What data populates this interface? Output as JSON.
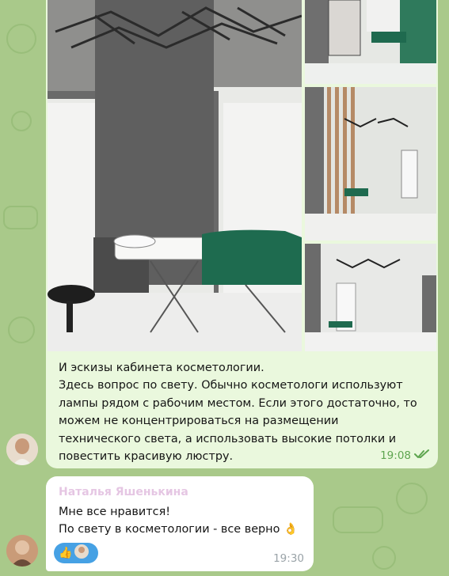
{
  "chat": {
    "outgoing": {
      "lines": [
        "И эскизы кабинета косметологии.",
        "Здесь вопрос по свету. Обычно косметологи используют",
        "лампы рядом с рабочим местом. Если этого достаточно, то",
        "можем не концентрироваться на размещении",
        "технического света, а использовать высокие потолки и",
        "повестить красивую люстру."
      ],
      "time": "19:08",
      "status_icon": "double-check-icon"
    },
    "incoming": {
      "sender": "Наталья Яшенькина",
      "lines": [
        "Мне все нравится!",
        "По свету в косметологии - все верно 👌"
      ],
      "time": "19:30",
      "reaction_emoji": "👍"
    }
  },
  "colors": {
    "background": "#a9c98a",
    "outgoing_bubble": "#eaf8dd",
    "incoming_bubble": "#ffffff",
    "accent_green": "#5ea54f",
    "reaction_blue": "#46a1e4",
    "sender_name": "#b65db0"
  }
}
